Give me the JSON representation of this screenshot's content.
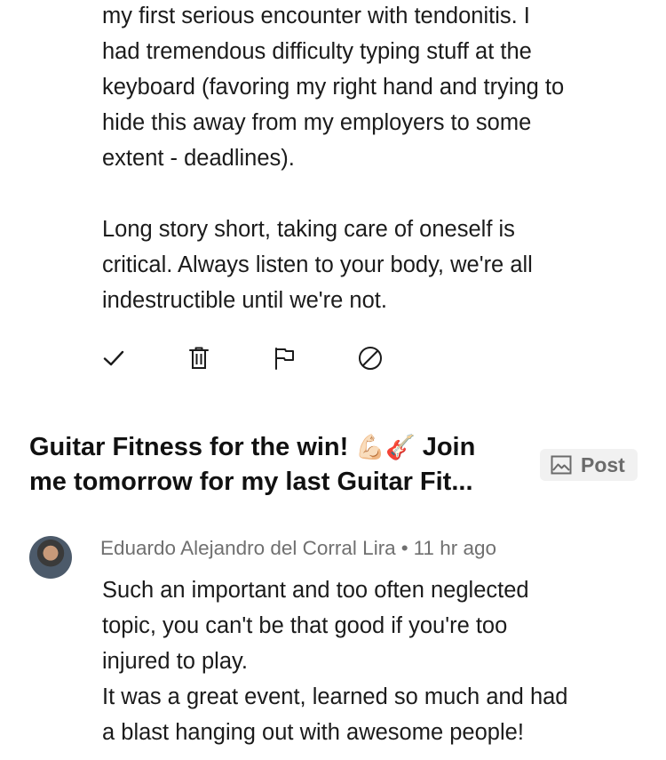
{
  "prior_comment": {
    "paragraph1_lines": [
      "my first serious encounter with tendonitis. I",
      "had tremendous difficulty typing stuff at the",
      "keyboard (favoring my right hand and trying to",
      "hide this away from my employers to some",
      "extent - deadlines)."
    ],
    "paragraph2_lines": [
      "Long story short, taking care of oneself is",
      "critical. Always listen to your body, we're all",
      "indestructible until we're not."
    ]
  },
  "actions": [
    {
      "name": "approve",
      "icon": "checkmark-icon"
    },
    {
      "name": "delete",
      "icon": "trash-icon"
    },
    {
      "name": "report",
      "icon": "flag-icon"
    },
    {
      "name": "block",
      "icon": "block-icon"
    }
  ],
  "post": {
    "title_part1": "Guitar Fitness for the win!",
    "title_emoji": "💪🏻🎸",
    "title_part2": "Join",
    "title_line2": "me tomorrow for my last Guitar Fit...",
    "badge_label": "Post",
    "badge_icon": "image-icon"
  },
  "comment": {
    "author": "Eduardo Alejandro del Corral Lira",
    "separator": "•",
    "time": "11 hr ago",
    "lines": [
      "Such an important and too often neglected",
      "topic, you can't be that good if you're too",
      "injured to play.",
      "It was a great event, learned so much and had",
      "a blast hanging out with awesome people!"
    ]
  },
  "colors": {
    "text": "#1b1b1b",
    "muted": "#707070",
    "badge_bg": "#f1f1f1"
  }
}
